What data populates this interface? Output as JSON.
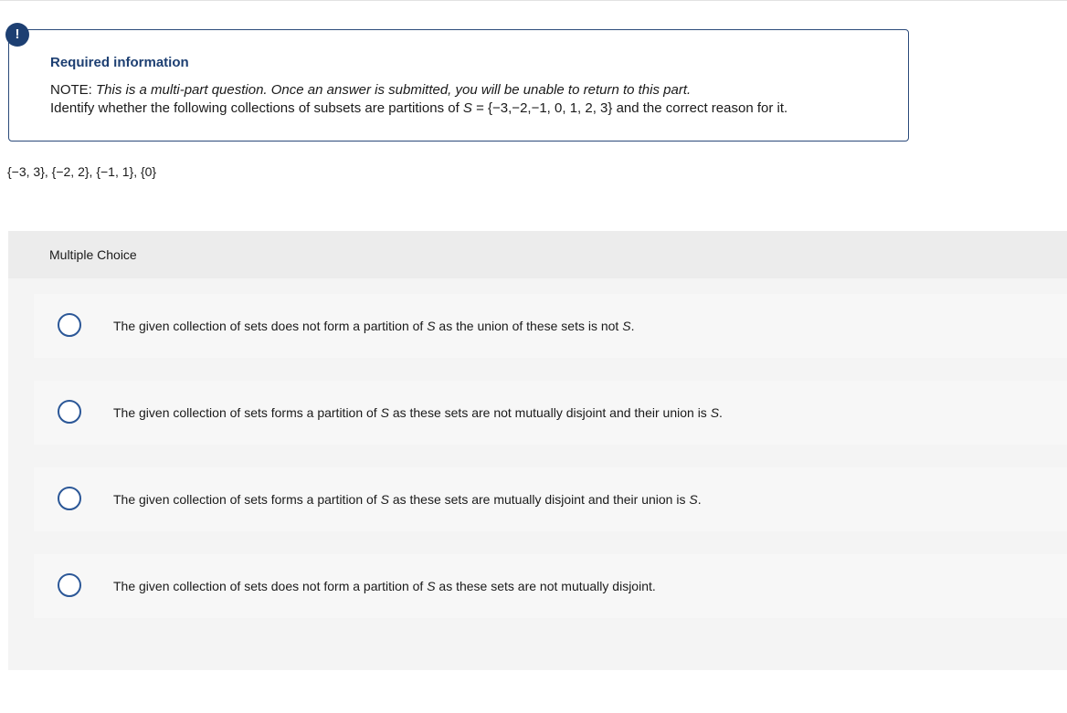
{
  "info": {
    "badge": "!",
    "title": "Required information",
    "note_label": "NOTE:",
    "note_body": "This is a multi-part question. Once an answer is submitted, you will be unable to return to this part.",
    "identify_prefix": "Identify whether the following collections of subsets are partitions of",
    "set_var": "S",
    "set_def": " = {−3,−2,−1, 0, 1, 2, 3}",
    "identify_suffix": " and the correct reason for it."
  },
  "question": {
    "collection": "{−3, 3}, {−2, 2}, {−1, 1}, {0}"
  },
  "multiple_choice": {
    "label": "Multiple Choice",
    "options": [
      {
        "pre": "The given collection of sets does not form a partition of ",
        "var": "S",
        "post": " as the union of these sets is not ",
        "var2": "S",
        "end": "."
      },
      {
        "pre": "The given collection of sets forms a partition of ",
        "var": "S",
        "post": " as these sets are not mutually disjoint and their union is ",
        "var2": "S",
        "end": "."
      },
      {
        "pre": "The given collection of sets forms a partition of ",
        "var": "S",
        "post": " as these sets are mutually disjoint and their union is ",
        "var2": "S",
        "end": "."
      },
      {
        "pre": "The given collection of sets does not form a partition of ",
        "var": "S",
        "post": " as these sets are not mutually disjoint.",
        "var2": "",
        "end": ""
      }
    ]
  },
  "colors": {
    "accent": "#1d3f72",
    "radio_border": "#2b5797",
    "panel_bg": "#f4f4f4"
  }
}
